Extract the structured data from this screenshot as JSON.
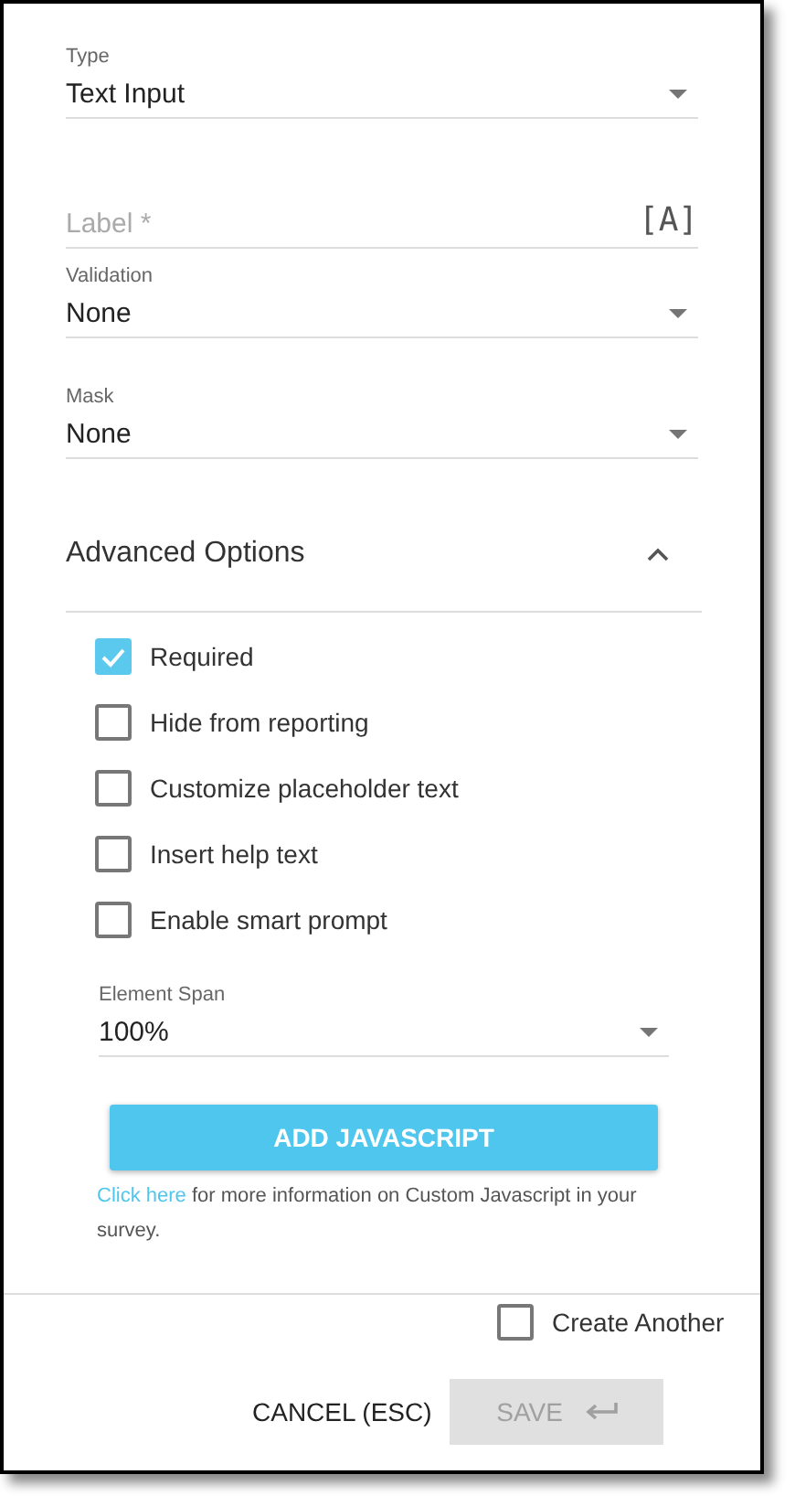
{
  "fields": [
    {
      "kind": "select",
      "label": "Type",
      "value": "Text Input"
    },
    {
      "kind": "text",
      "placeholder": "Label *",
      "action": "[A]"
    },
    {
      "kind": "select",
      "label": "Validation",
      "value": "None"
    },
    {
      "kind": "select",
      "label": "Mask",
      "value": "None"
    }
  ],
  "advanced": {
    "title": "Advanced Options",
    "expanded": true,
    "options": [
      {
        "label": "Required",
        "checked": true
      },
      {
        "label": "Hide from reporting",
        "checked": false
      },
      {
        "label": "Customize placeholder text",
        "checked": false
      },
      {
        "label": "Insert help text",
        "checked": false
      },
      {
        "label": "Enable smart prompt",
        "checked": false
      }
    ],
    "element_span": {
      "label": "Element Span",
      "value": "100%"
    },
    "javascript_button": "ADD JAVASCRIPT",
    "info": {
      "link": "Click here",
      "text": " for more information on Custom Javascript in your survey."
    }
  },
  "footer": {
    "create_another": {
      "label": "Create Another",
      "checked": false
    },
    "cancel": "CANCEL (ESC)",
    "save": {
      "label": "SAVE",
      "disabled": true
    }
  }
}
